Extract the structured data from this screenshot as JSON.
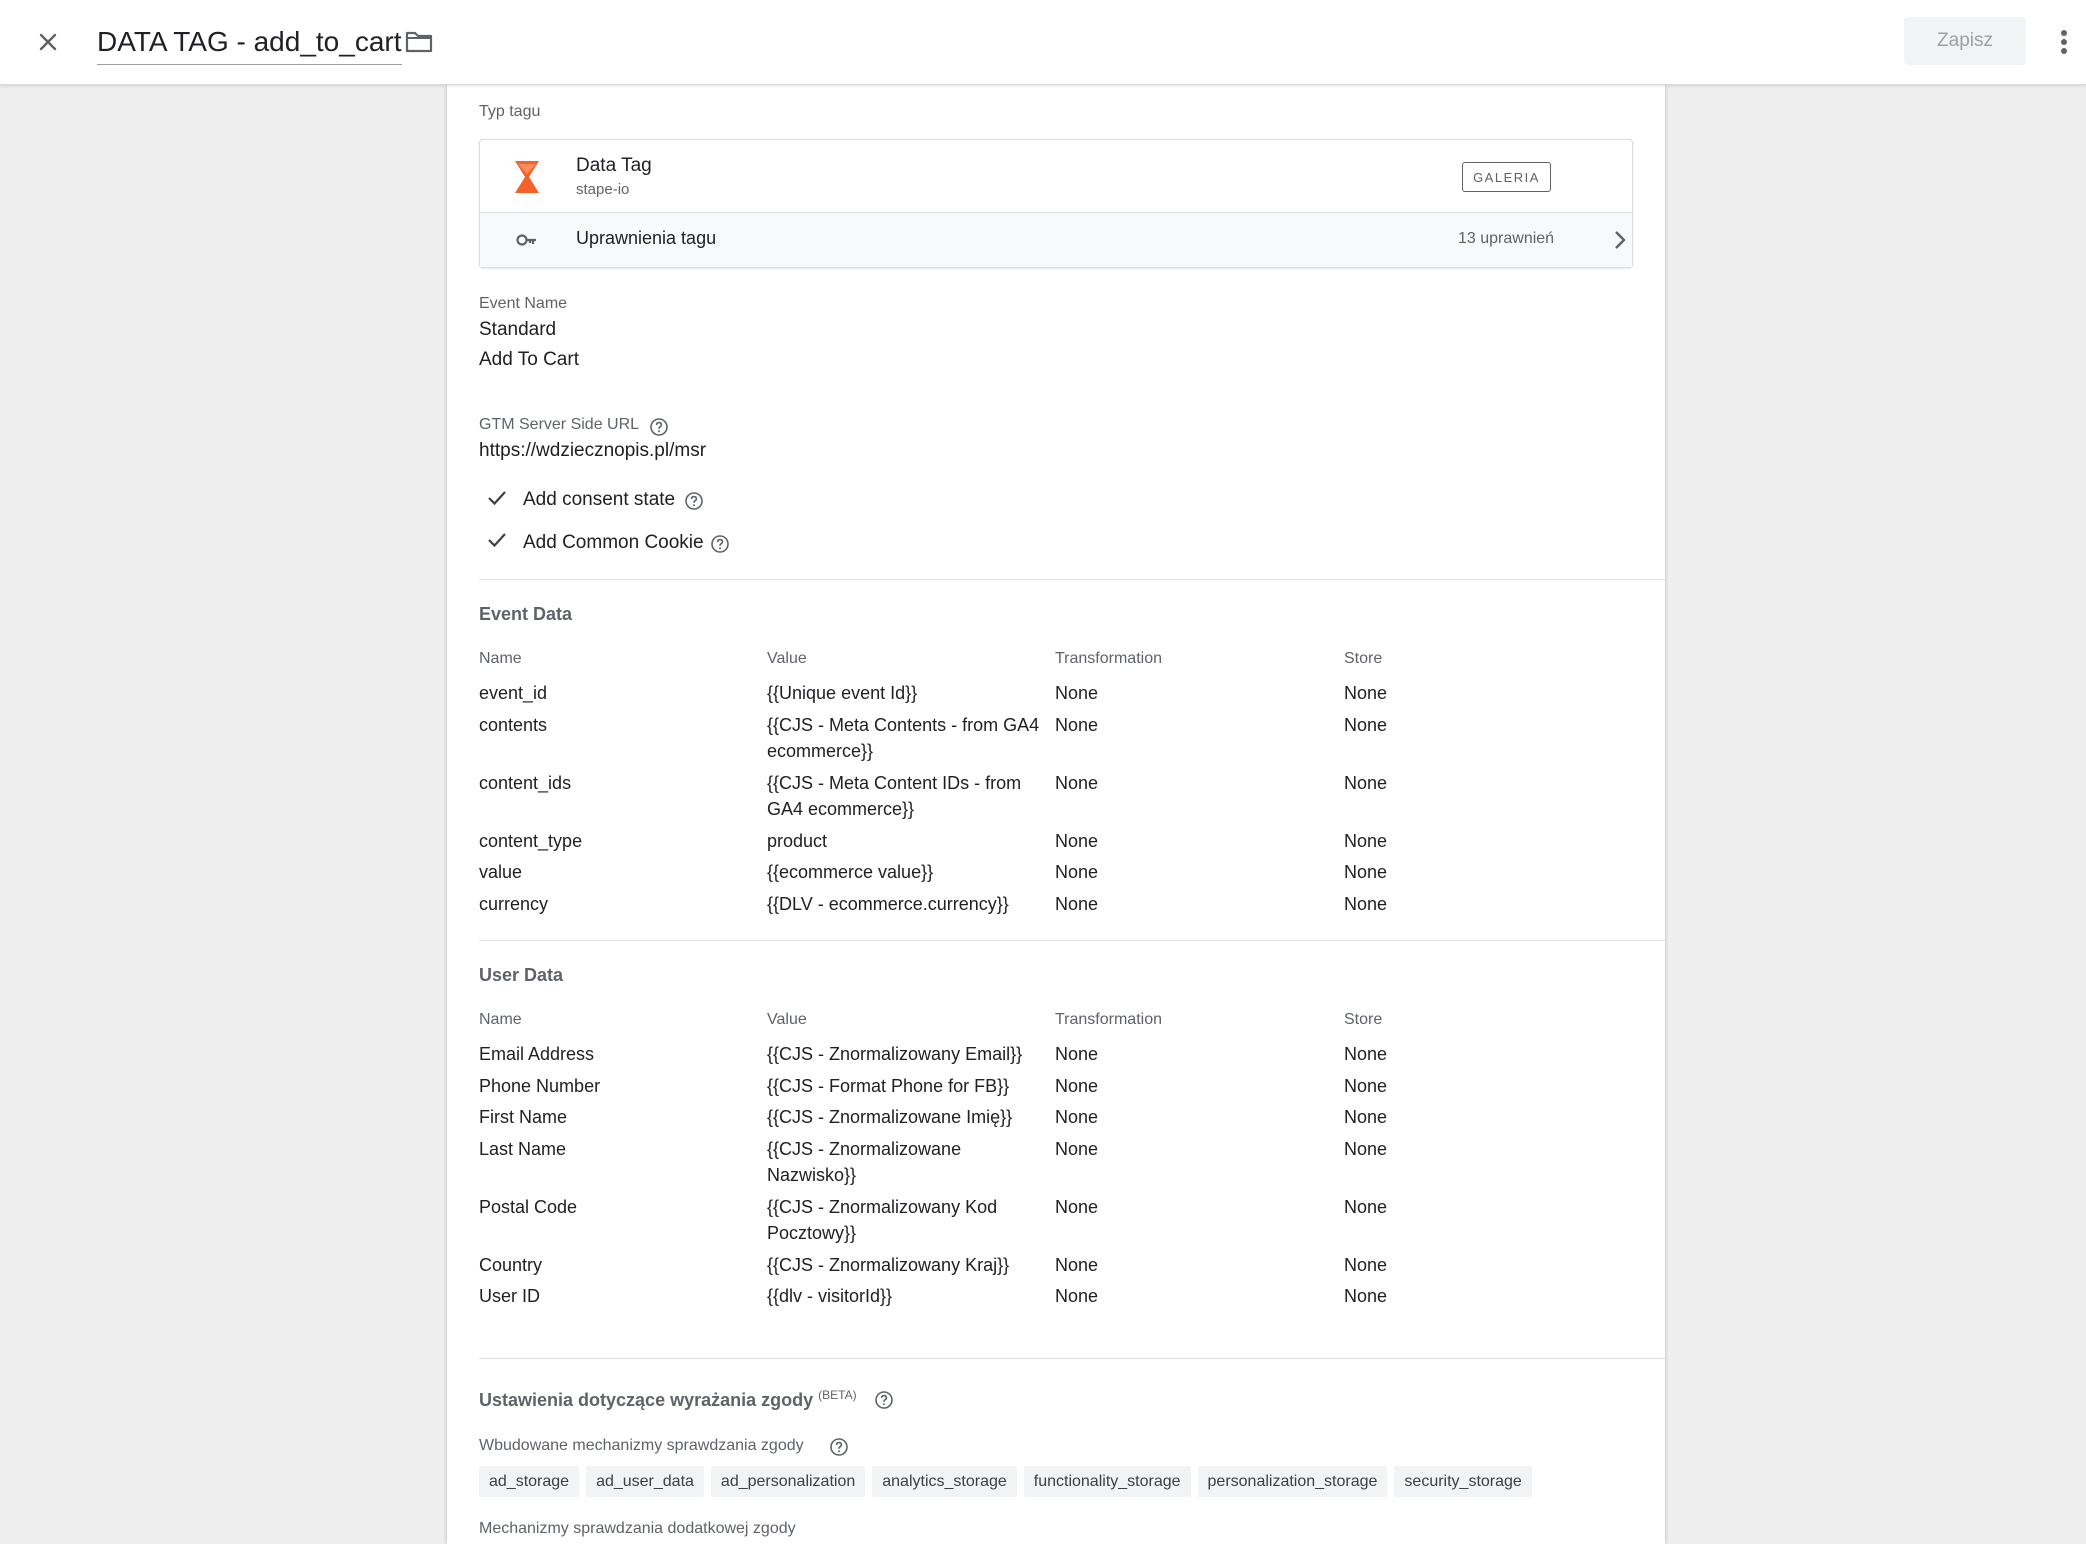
{
  "header": {
    "title": "DATA TAG - add_to_cart",
    "save_label": "Zapisz"
  },
  "tag_type": {
    "section_label": "Typ tagu",
    "name": "Data Tag",
    "vendor": "stape-io",
    "gallery_label": "GALERIA",
    "permissions_label": "Uprawnienia tagu",
    "permissions_count": "13 uprawnień"
  },
  "event_name": {
    "label": "Event Name",
    "type": "Standard",
    "value": "Add To Cart"
  },
  "server_url": {
    "label": "GTM Server Side URL",
    "value": "https://wdziecznopis.pl/msr"
  },
  "options": [
    {
      "label": "Add consent state",
      "checked": true
    },
    {
      "label": "Add Common Cookie",
      "checked": true
    }
  ],
  "event_data": {
    "title": "Event Data",
    "columns": [
      "Name",
      "Value",
      "Transformation",
      "Store"
    ],
    "rows": [
      [
        "event_id",
        "{{Unique event Id}}",
        "None",
        "None"
      ],
      [
        "contents",
        "{{CJS - Meta Contents - from GA4 ecommerce}}",
        "None",
        "None"
      ],
      [
        "content_ids",
        "{{CJS - Meta Content IDs - from GA4 ecommerce}}",
        "None",
        "None"
      ],
      [
        "content_type",
        "product",
        "None",
        "None"
      ],
      [
        "value",
        "{{ecommerce value}}",
        "None",
        "None"
      ],
      [
        "currency",
        "{{DLV - ecommerce.currency}}",
        "None",
        "None"
      ]
    ]
  },
  "user_data": {
    "title": "User Data",
    "columns": [
      "Name",
      "Value",
      "Transformation",
      "Store"
    ],
    "rows": [
      [
        "Email Address",
        "{{CJS - Znormalizowany Email}}",
        "None",
        "None"
      ],
      [
        "Phone Number",
        "{{CJS - Format Phone for FB}}",
        "None",
        "None"
      ],
      [
        "First Name",
        "{{CJS - Znormalizowane Imię}}",
        "None",
        "None"
      ],
      [
        "Last Name",
        "{{CJS - Znormalizowane Nazwisko}}",
        "None",
        "None"
      ],
      [
        "Postal Code",
        "{{CJS - Znormalizowany Kod Pocztowy}}",
        "None",
        "None"
      ],
      [
        "Country",
        "{{CJS - Znormalizowany Kraj}}",
        "None",
        "None"
      ],
      [
        "User ID",
        "{{dlv - visitorId}}",
        "None",
        "None"
      ]
    ]
  },
  "consent": {
    "title": "Ustawienia dotyczące wyrażania zgody",
    "badge": "(BETA)",
    "builtin_label": "Wbudowane mechanizmy sprawdzania zgody",
    "builtin_chips": [
      "ad_storage",
      "ad_user_data",
      "ad_personalization",
      "analytics_storage",
      "functionality_storage",
      "personalization_storage",
      "security_storage"
    ],
    "additional_label": "Mechanizmy sprawdzania dodatkowej zgody"
  },
  "colors": {
    "tag_icon": "#f4622a",
    "save_disabled_bg": "#f1f3f4",
    "save_disabled_text": "#9aa0a6"
  },
  "icons": {
    "close": "close-icon",
    "folder": "folder-icon",
    "more": "more-vert-icon",
    "tag": "data-tag-icon",
    "key": "key-icon",
    "chevron": "chevron-right-icon",
    "help": "help-icon",
    "check": "check-icon"
  }
}
